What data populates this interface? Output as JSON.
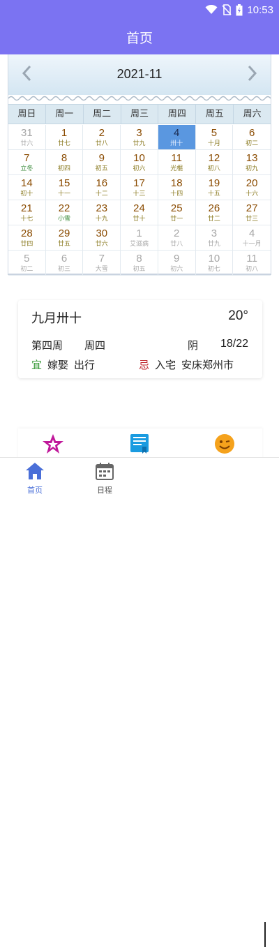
{
  "status_bar": {
    "time": "10:53"
  },
  "app_bar": {
    "title": "首页"
  },
  "calendar": {
    "month": "2021-11",
    "weekdays": [
      "周日",
      "周一",
      "周二",
      "周三",
      "周四",
      "周五",
      "周六"
    ],
    "days": [
      {
        "d": "31",
        "l": "廿六",
        "out": true
      },
      {
        "d": "1",
        "l": "廿七"
      },
      {
        "d": "2",
        "l": "廿八"
      },
      {
        "d": "3",
        "l": "廿九"
      },
      {
        "d": "4",
        "l": "卅十",
        "selected": true
      },
      {
        "d": "5",
        "l": "十月"
      },
      {
        "d": "6",
        "l": "初二"
      },
      {
        "d": "7",
        "l": "立冬",
        "festival": true
      },
      {
        "d": "8",
        "l": "初四"
      },
      {
        "d": "9",
        "l": "初五"
      },
      {
        "d": "10",
        "l": "初六"
      },
      {
        "d": "11",
        "l": "光棍"
      },
      {
        "d": "12",
        "l": "初八"
      },
      {
        "d": "13",
        "l": "初九"
      },
      {
        "d": "14",
        "l": "初十"
      },
      {
        "d": "15",
        "l": "十一"
      },
      {
        "d": "16",
        "l": "十二"
      },
      {
        "d": "17",
        "l": "十三"
      },
      {
        "d": "18",
        "l": "十四"
      },
      {
        "d": "19",
        "l": "十五"
      },
      {
        "d": "20",
        "l": "十六"
      },
      {
        "d": "21",
        "l": "十七"
      },
      {
        "d": "22",
        "l": "小雪",
        "festival": true
      },
      {
        "d": "23",
        "l": "十九"
      },
      {
        "d": "24",
        "l": "廿十"
      },
      {
        "d": "25",
        "l": "廿一"
      },
      {
        "d": "26",
        "l": "廿二"
      },
      {
        "d": "27",
        "l": "廿三"
      },
      {
        "d": "28",
        "l": "廿四"
      },
      {
        "d": "29",
        "l": "廿五"
      },
      {
        "d": "30",
        "l": "廿六"
      },
      {
        "d": "1",
        "l": "艾滋病",
        "out": true
      },
      {
        "d": "2",
        "l": "廿八",
        "out": true
      },
      {
        "d": "3",
        "l": "廿九",
        "out": true
      },
      {
        "d": "4",
        "l": "十一月",
        "out": true
      },
      {
        "d": "5",
        "l": "初二",
        "out": true
      },
      {
        "d": "6",
        "l": "初三",
        "out": true
      },
      {
        "d": "7",
        "l": "大雪",
        "out": true
      },
      {
        "d": "8",
        "l": "初五",
        "out": true
      },
      {
        "d": "9",
        "l": "初六",
        "out": true
      },
      {
        "d": "10",
        "l": "初七",
        "out": true
      },
      {
        "d": "11",
        "l": "初八",
        "out": true
      }
    ]
  },
  "info": {
    "lunar_date": "九月卅十",
    "temperature": "20°",
    "week_number": "第四周",
    "weekday": "周四",
    "weather": "阴",
    "temp_range": "18/22",
    "yi_label": "宜",
    "yi_items": [
      "嫁娶",
      "出行"
    ],
    "ji_label": "忌",
    "ji_items": [
      "入宅",
      "安床郑州市"
    ]
  },
  "shortcuts": [
    "star-icon",
    "book-icon",
    "smiley-icon"
  ],
  "tabs": [
    {
      "label": "首页",
      "icon": "home-icon",
      "active": true
    },
    {
      "label": "日程",
      "icon": "calendar-icon",
      "active": false
    }
  ],
  "colors": {
    "primary": "#7b73f2",
    "selected_day": "#5a97e0",
    "yi": "#3a9a3a",
    "ji": "#c0282e",
    "tab_active": "#4a6fd8"
  }
}
